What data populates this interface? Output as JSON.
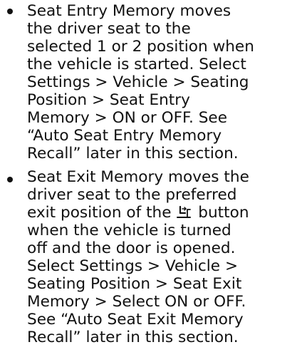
{
  "bullets": [
    {
      "lines": [
        "Seat Entry Memory moves",
        "the driver seat to the",
        "selected 1 or 2 position when",
        "the vehicle is started. Select",
        "Settings > Vehicle > Seating",
        "Position > Seat Entry",
        "Memory > ON or OFF. See",
        "“Auto Seat Entry Memory",
        "Recall” later in this section."
      ]
    },
    {
      "lines": [
        "Seat Exit Memory moves the",
        "driver seat to the preferred"
      ],
      "icon_line": {
        "before": "exit position of the",
        "icon": "seat-exit-icon",
        "after": "button"
      },
      "lines_after": [
        "when the vehicle is turned",
        "off and the door is opened.",
        "Select Settings > Vehicle >",
        "Seating Position > Seat Exit",
        "Memory > Select ON or OFF.",
        "See “Auto Seat Exit Memory",
        "Recall” later in this section."
      ]
    }
  ]
}
